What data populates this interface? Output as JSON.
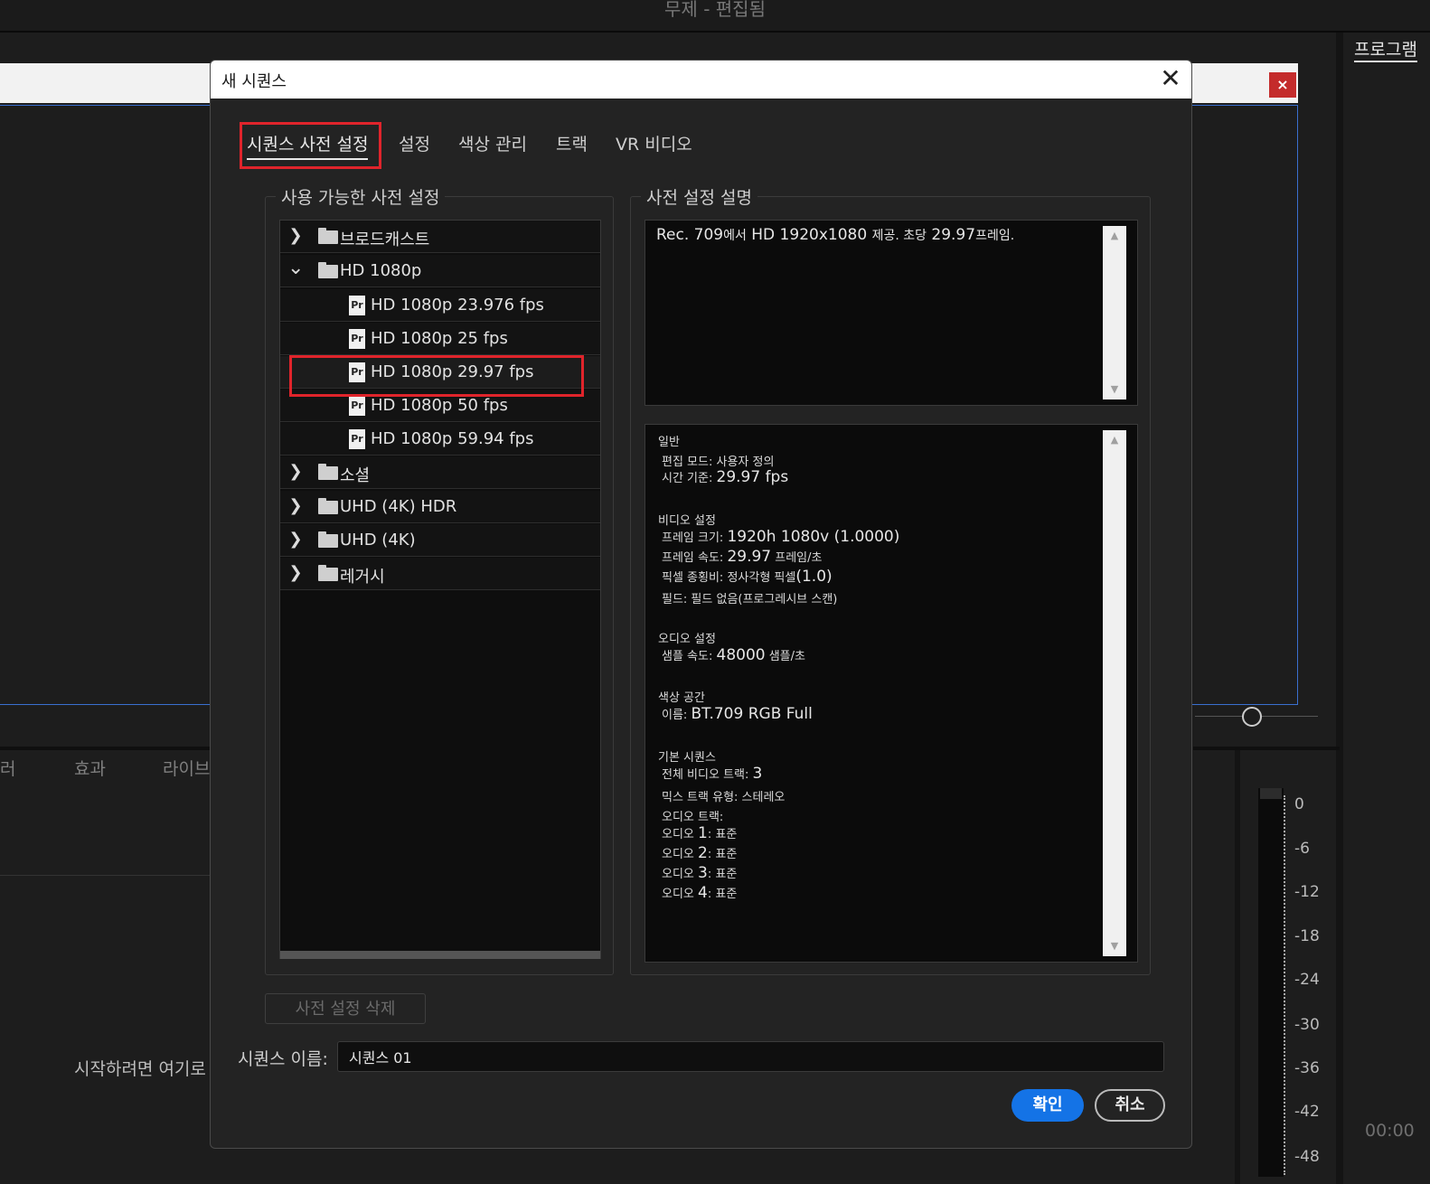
{
  "app": {
    "window_title": "무제 - 편집됨",
    "program_tab": "프로그램",
    "bottom_tabs": [
      "러",
      "효과",
      "라이브"
    ],
    "start_hint": "시작하려면 여기로",
    "timecode": "00:00",
    "meter_labels": [
      "0",
      "-6",
      "-12",
      "-18",
      "-24",
      "-30",
      "-36",
      "-42",
      "-48"
    ],
    "close_glyph": "×"
  },
  "dialog": {
    "title": "새 시퀀스",
    "close_glyph": "✕",
    "tabs": [
      {
        "label": "시퀀스 사전 설정",
        "active": true
      },
      {
        "label": "설정"
      },
      {
        "label": "색상 관리"
      },
      {
        "label": "트랙"
      },
      {
        "label": "VR 비디오"
      }
    ],
    "presets_group_label": "사용 가능한 사전 설정",
    "description_group_label": "사전 설정 설명",
    "tree": [
      {
        "type": "folder",
        "expanded": false,
        "label": "브로드캐스트",
        "chevron": "❯"
      },
      {
        "type": "folder",
        "expanded": true,
        "label": "HD 1080p",
        "chevron": "⌄"
      },
      {
        "type": "preset",
        "label": "HD 1080p 23.976 fps",
        "icon": "Pr"
      },
      {
        "type": "preset",
        "label": "HD 1080p 25 fps",
        "icon": "Pr"
      },
      {
        "type": "preset",
        "label": "HD 1080p 29.97 fps",
        "icon": "Pr",
        "selected": true
      },
      {
        "type": "preset",
        "label": "HD 1080p 50 fps",
        "icon": "Pr"
      },
      {
        "type": "preset",
        "label": "HD 1080p 59.94 fps",
        "icon": "Pr"
      },
      {
        "type": "folder",
        "expanded": false,
        "label": "소셜",
        "chevron": "❯"
      },
      {
        "type": "folder",
        "expanded": false,
        "label": "UHD (4K) HDR",
        "chevron": "❯"
      },
      {
        "type": "folder",
        "expanded": false,
        "label": "UHD (4K)",
        "chevron": "❯"
      },
      {
        "type": "folder",
        "expanded": false,
        "label": "레거시",
        "chevron": "❯"
      }
    ],
    "description": {
      "p1": "Rec. 709",
      "p2": "에서",
      "p3": " HD 1920x1080 ",
      "p4": "제공. 초당",
      "p5": " 29.97",
      "p6": "프레임."
    },
    "info": {
      "general_header": "일반",
      "edit_mode": "편집 모드: 사용자 정의",
      "timebase_label": "시간 기준: ",
      "timebase_value": "29.97 fps",
      "video_header": "비디오 설정",
      "frame_size_label": "프레임 크기: ",
      "frame_size_value": "1920h 1080v (1.0000)",
      "frame_rate_label": "프레임 속도: ",
      "frame_rate_value": "29.97",
      "frame_rate_unit": " 프레임/초",
      "pixel_aspect_label": "픽셀 종횡비: 정사각형 픽셀",
      "pixel_aspect_value": "(1.0)",
      "fields": "필드: 필드 없음(프로그레시브 스캔)",
      "audio_header": "오디오 설정",
      "sample_rate_label": "샘플 속도: ",
      "sample_rate_value": "48000",
      "sample_rate_unit": " 샘플/초",
      "color_header": "색상 공간",
      "color_name_label": "이름: ",
      "color_name_value": "BT.709 RGB Full",
      "seq_header": "기본 시퀀스",
      "total_video_label": "전체 비디오 트랙: ",
      "total_video_value": "3",
      "mix_track": "믹스 트랙 유형: 스테레오",
      "audio_tracks": "오디오 트랙:",
      "audio_prefix": "오디오 ",
      "audio_1": "1",
      "audio_2": "2",
      "audio_3": "3",
      "audio_4": "4",
      "audio_suffix": ": 표준"
    },
    "delete_button": "사전 설정 삭제",
    "name_label": "시퀀스 이름:",
    "name_value": "시퀀스 01",
    "ok_button": "확인",
    "cancel_button": "취소",
    "scroll_up": "▲",
    "scroll_down": "▼"
  }
}
